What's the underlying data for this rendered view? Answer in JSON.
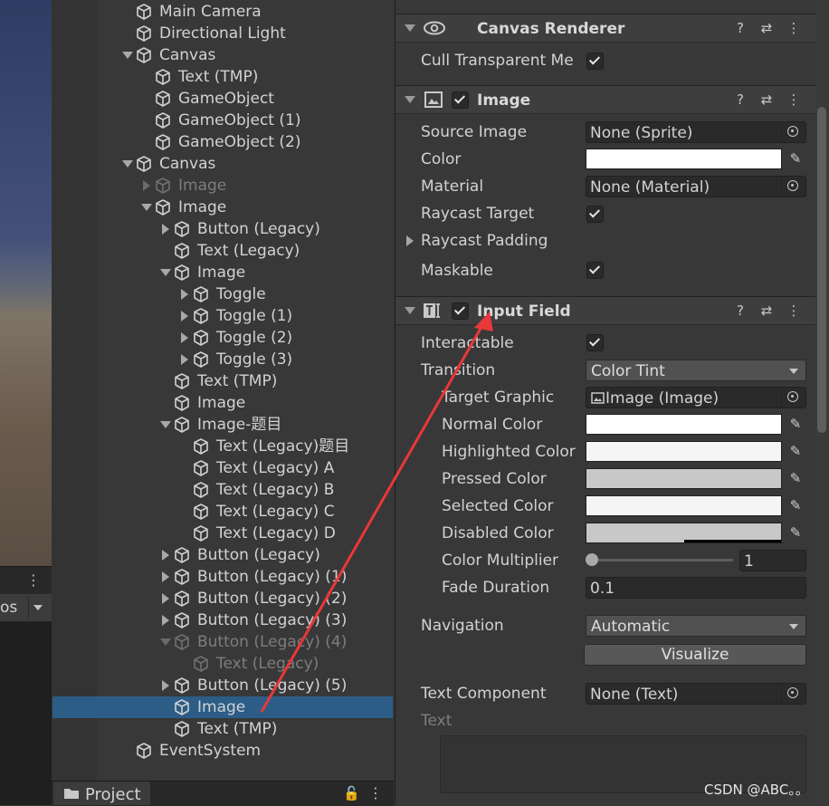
{
  "scene": {
    "partial_label": "os"
  },
  "hierarchy": {
    "items": [
      {
        "label": "Main Camera",
        "depth": 1,
        "fold": "none",
        "dim": false,
        "selected": false
      },
      {
        "label": "Directional Light",
        "depth": 1,
        "fold": "none",
        "dim": false,
        "selected": false
      },
      {
        "label": "Canvas",
        "depth": 1,
        "fold": "down",
        "dim": false,
        "selected": false
      },
      {
        "label": "Text (TMP)",
        "depth": 2,
        "fold": "none",
        "dim": false,
        "selected": false
      },
      {
        "label": "GameObject",
        "depth": 2,
        "fold": "none",
        "dim": false,
        "selected": false
      },
      {
        "label": "GameObject (1)",
        "depth": 2,
        "fold": "none",
        "dim": false,
        "selected": false
      },
      {
        "label": "GameObject (2)",
        "depth": 2,
        "fold": "none",
        "dim": false,
        "selected": false
      },
      {
        "label": "Canvas",
        "depth": 1,
        "fold": "down",
        "dim": false,
        "selected": false
      },
      {
        "label": "Image",
        "depth": 2,
        "fold": "right",
        "dim": true,
        "selected": false
      },
      {
        "label": "Image",
        "depth": 2,
        "fold": "down",
        "dim": false,
        "selected": false
      },
      {
        "label": "Button (Legacy)",
        "depth": 3,
        "fold": "right",
        "dim": false,
        "selected": false
      },
      {
        "label": "Text (Legacy)",
        "depth": 3,
        "fold": "none",
        "dim": false,
        "selected": false
      },
      {
        "label": "Image",
        "depth": 3,
        "fold": "down",
        "dim": false,
        "selected": false
      },
      {
        "label": "Toggle",
        "depth": 4,
        "fold": "right",
        "dim": false,
        "selected": false
      },
      {
        "label": "Toggle (1)",
        "depth": 4,
        "fold": "right",
        "dim": false,
        "selected": false
      },
      {
        "label": "Toggle (2)",
        "depth": 4,
        "fold": "right",
        "dim": false,
        "selected": false
      },
      {
        "label": "Toggle (3)",
        "depth": 4,
        "fold": "right",
        "dim": false,
        "selected": false
      },
      {
        "label": "Text (TMP)",
        "depth": 3,
        "fold": "none",
        "dim": false,
        "selected": false
      },
      {
        "label": "Image",
        "depth": 3,
        "fold": "none",
        "dim": false,
        "selected": false
      },
      {
        "label": "Image-题目",
        "depth": 3,
        "fold": "down",
        "dim": false,
        "selected": false
      },
      {
        "label": "Text (Legacy)题目",
        "depth": 4,
        "fold": "none",
        "dim": false,
        "selected": false
      },
      {
        "label": "Text (Legacy) A",
        "depth": 4,
        "fold": "none",
        "dim": false,
        "selected": false
      },
      {
        "label": "Text (Legacy) B",
        "depth": 4,
        "fold": "none",
        "dim": false,
        "selected": false
      },
      {
        "label": "Text (Legacy) C",
        "depth": 4,
        "fold": "none",
        "dim": false,
        "selected": false
      },
      {
        "label": "Text (Legacy) D",
        "depth": 4,
        "fold": "none",
        "dim": false,
        "selected": false
      },
      {
        "label": "Button (Legacy)",
        "depth": 3,
        "fold": "right",
        "dim": false,
        "selected": false
      },
      {
        "label": "Button (Legacy) (1)",
        "depth": 3,
        "fold": "right",
        "dim": false,
        "selected": false
      },
      {
        "label": "Button (Legacy) (2)",
        "depth": 3,
        "fold": "right",
        "dim": false,
        "selected": false
      },
      {
        "label": "Button (Legacy) (3)",
        "depth": 3,
        "fold": "right",
        "dim": false,
        "selected": false
      },
      {
        "label": "Button (Legacy) (4)",
        "depth": 3,
        "fold": "down",
        "dim": true,
        "selected": false
      },
      {
        "label": "Text (Legacy)",
        "depth": 4,
        "fold": "none",
        "dim": true,
        "selected": false
      },
      {
        "label": "Button (Legacy) (5)",
        "depth": 3,
        "fold": "right",
        "dim": false,
        "selected": false
      },
      {
        "label": "Image",
        "depth": 3,
        "fold": "none",
        "dim": false,
        "selected": true
      },
      {
        "label": "Text (TMP)",
        "depth": 3,
        "fold": "none",
        "dim": false,
        "selected": false
      },
      {
        "label": "EventSystem",
        "depth": 1,
        "fold": "none",
        "dim": false,
        "selected": false
      }
    ]
  },
  "project": {
    "tab_label": "Project"
  },
  "inspector": {
    "canvas_renderer": {
      "title": "Canvas Renderer",
      "cull_label": "Cull Transparent Me"
    },
    "image": {
      "title": "Image",
      "source_image_label": "Source Image",
      "source_image_value": "None (Sprite)",
      "color_label": "Color",
      "color_value": "#ffffff",
      "material_label": "Material",
      "material_value": "None (Material)",
      "raycast_target_label": "Raycast Target",
      "raycast_padding_label": "Raycast Padding",
      "maskable_label": "Maskable"
    },
    "input_field": {
      "title": "Input Field",
      "interactable_label": "Interactable",
      "transition_label": "Transition",
      "transition_value": "Color Tint",
      "target_graphic_label": "Target Graphic",
      "target_graphic_value": "Image (Image)",
      "normal_color_label": "Normal Color",
      "normal_color_value": "#ffffff",
      "highlighted_color_label": "Highlighted Color",
      "highlighted_color_value": "#f5f5f5",
      "pressed_color_label": "Pressed Color",
      "pressed_color_value": "#c8c8c8",
      "selected_color_label": "Selected Color",
      "selected_color_value": "#f5f5f5",
      "disabled_color_label": "Disabled Color",
      "disabled_color_value": "#c8c8c8",
      "color_multiplier_label": "Color Multiplier",
      "color_multiplier_value": "1",
      "fade_duration_label": "Fade Duration",
      "fade_duration_value": "0.1",
      "navigation_label": "Navigation",
      "navigation_value": "Automatic",
      "visualize_label": "Visualize",
      "text_component_label": "Text Component",
      "text_component_value": "None (Text)",
      "text_label": "Text"
    }
  },
  "watermark": "CSDN @ABC。。",
  "colors": {
    "selection": "#2c5d87",
    "annotation_arrow": "#e8383a"
  }
}
